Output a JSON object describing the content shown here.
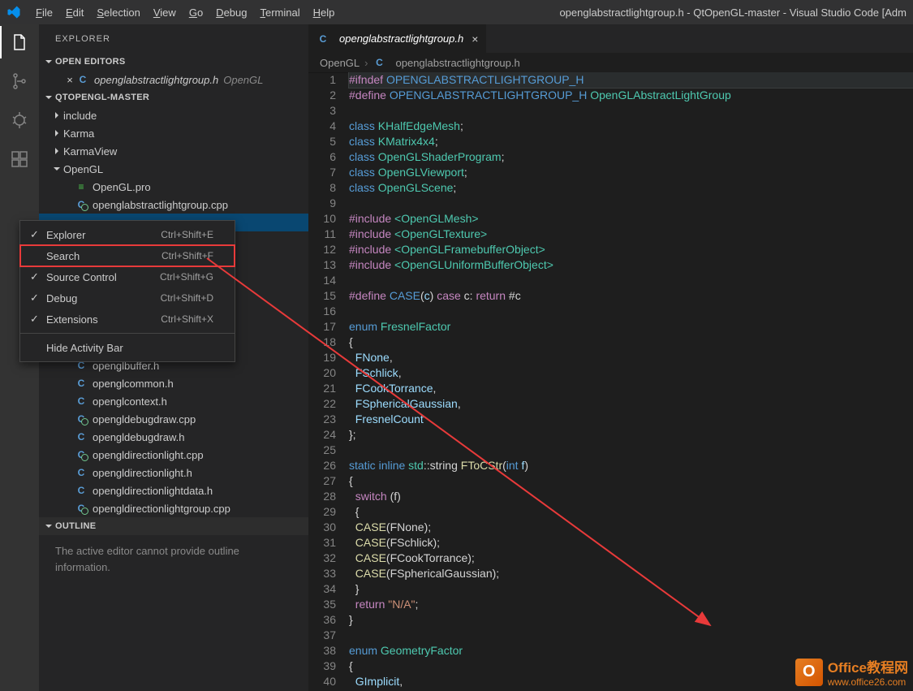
{
  "titlebar": {
    "menu": [
      "File",
      "Edit",
      "Selection",
      "View",
      "Go",
      "Debug",
      "Terminal",
      "Help"
    ],
    "title": "openglabstractlightgroup.h - QtOpenGL-master - Visual Studio Code [Adm"
  },
  "sidebar": {
    "title": "EXPLORER",
    "openEditorsLabel": "OPEN EDITORS",
    "openEditor": {
      "file": "openglabstractlightgroup.h",
      "folder": "OpenGL"
    },
    "projectLabel": "QTOPENGL-MASTER",
    "folders": [
      "include",
      "Karma",
      "KarmaView",
      "OpenGL"
    ],
    "filesTop": [
      {
        "icon": "qt",
        "name": "OpenGL.pro"
      },
      {
        "icon": "cg",
        "name": "openglabstractlightgroup.cpp"
      }
    ],
    "filesBottom": [
      {
        "icon": "c",
        "name": "openglbuffer.h"
      },
      {
        "icon": "c",
        "name": "openglcommon.h"
      },
      {
        "icon": "c",
        "name": "openglcontext.h"
      },
      {
        "icon": "cg",
        "name": "opengldebugdraw.cpp"
      },
      {
        "icon": "c",
        "name": "opengldebugdraw.h"
      },
      {
        "icon": "cg",
        "name": "opengldirectionlight.cpp"
      },
      {
        "icon": "c",
        "name": "opengldirectionlight.h"
      },
      {
        "icon": "c",
        "name": "opengldirectionlightdata.h"
      },
      {
        "icon": "cg",
        "name": "opengldirectionlightgroup.cpp"
      }
    ],
    "selectedHidden": "openglabstractlightgroup.h",
    "outlineLabel": "OUTLINE",
    "outlineMsg": "The active editor cannot provide outline information."
  },
  "contextMenu": [
    {
      "check": true,
      "label": "Explorer",
      "key": "Ctrl+Shift+E"
    },
    {
      "check": false,
      "label": "Search",
      "key": "Ctrl+Shift+F",
      "hl": true
    },
    {
      "check": true,
      "label": "Source Control",
      "key": "Ctrl+Shift+G"
    },
    {
      "check": true,
      "label": "Debug",
      "key": "Ctrl+Shift+D"
    },
    {
      "check": true,
      "label": "Extensions",
      "key": "Ctrl+Shift+X"
    },
    {
      "sep": true
    },
    {
      "check": false,
      "label": "Hide Activity Bar",
      "key": ""
    }
  ],
  "editor": {
    "tab": "openglabstractlightgroup.h",
    "breadcrumb": {
      "folder": "OpenGL",
      "file": "openglabstractlightgroup.h"
    }
  },
  "code": [
    {
      "n": 1,
      "hl": true,
      "h": "<span class='tk-pp'>#ifndef</span> <span class='tk-mac'>OPENGLABSTRACTLIGHTGROUP_H</span>"
    },
    {
      "n": 2,
      "h": "<span class='tk-pp'>#define</span> <span class='tk-mac'>OPENGLABSTRACTLIGHTGROUP_H</span> <span class='tk-cls'>OpenGLAbstractLightGroup</span>"
    },
    {
      "n": 3,
      "h": ""
    },
    {
      "n": 4,
      "h": "<span class='tk-kw'>class</span> <span class='tk-cls'>KHalfEdgeMesh</span>;"
    },
    {
      "n": 5,
      "h": "<span class='tk-kw'>class</span> <span class='tk-cls'>KMatrix4x4</span>;"
    },
    {
      "n": 6,
      "h": "<span class='tk-kw'>class</span> <span class='tk-cls'>OpenGLShaderProgram</span>;"
    },
    {
      "n": 7,
      "h": "<span class='tk-kw'>class</span> <span class='tk-cls'>OpenGLViewport</span>;"
    },
    {
      "n": 8,
      "h": "<span class='tk-kw'>class</span> <span class='tk-cls'>OpenGLScene</span>;"
    },
    {
      "n": 9,
      "h": ""
    },
    {
      "n": 10,
      "h": "<span class='tk-pp'>#include</span> <span class='tk-cls'>&lt;OpenGLMesh&gt;</span>"
    },
    {
      "n": 11,
      "h": "<span class='tk-pp'>#include</span> <span class='tk-cls'>&lt;OpenGLTexture&gt;</span>"
    },
    {
      "n": 12,
      "h": "<span class='tk-pp'>#include</span> <span class='tk-cls'>&lt;OpenGLFramebufferObject&gt;</span>"
    },
    {
      "n": 13,
      "h": "<span class='tk-pp'>#include</span> <span class='tk-cls'>&lt;OpenGLUniformBufferObject&gt;</span>"
    },
    {
      "n": 14,
      "h": ""
    },
    {
      "n": 15,
      "h": "<span class='tk-pp'>#define</span> <span class='tk-mac'>CASE</span>(<span class='tk-var'>c</span>) <span class='tk-pp'>case</span> c: <span class='tk-pp'>return</span> #c"
    },
    {
      "n": 16,
      "h": ""
    },
    {
      "n": 17,
      "h": "<span class='tk-kw'>enum</span> <span class='tk-cls'>FresnelFactor</span>"
    },
    {
      "n": 18,
      "h": "{"
    },
    {
      "n": 19,
      "h": "  <span class='tk-var'>FNone</span>,"
    },
    {
      "n": 20,
      "h": "  <span class='tk-var'>FSchlick</span>,"
    },
    {
      "n": 21,
      "h": "  <span class='tk-var'>FCookTorrance</span>,"
    },
    {
      "n": 22,
      "h": "  <span class='tk-var'>FSphericalGaussian</span>,"
    },
    {
      "n": 23,
      "h": "  <span class='tk-var'>FresnelCount</span>"
    },
    {
      "n": 24,
      "h": "};"
    },
    {
      "n": 25,
      "h": ""
    },
    {
      "n": 26,
      "h": "<span class='tk-kw'>static</span> <span class='tk-kw'>inline</span> <span class='tk-ty'>std</span>::string <span class='tk-fn'>FToCStr</span>(<span class='tk-kw'>int</span> <span class='tk-var'>f</span>)"
    },
    {
      "n": 27,
      "h": "{"
    },
    {
      "n": 28,
      "h": "  <span class='tk-pp'>switch</span> (f)"
    },
    {
      "n": 29,
      "h": "  {"
    },
    {
      "n": 30,
      "h": "  <span class='tk-fn'>CASE</span>(FNone);"
    },
    {
      "n": 31,
      "h": "  <span class='tk-fn'>CASE</span>(FSchlick);"
    },
    {
      "n": 32,
      "h": "  <span class='tk-fn'>CASE</span>(FCookTorrance);"
    },
    {
      "n": 33,
      "h": "  <span class='tk-fn'>CASE</span>(FSphericalGaussian);"
    },
    {
      "n": 34,
      "h": "  }"
    },
    {
      "n": 35,
      "h": "  <span class='tk-pp'>return</span> <span class='tk-str'>\"N/A\"</span>;"
    },
    {
      "n": 36,
      "h": "}"
    },
    {
      "n": 37,
      "h": ""
    },
    {
      "n": 38,
      "h": "<span class='tk-kw'>enum</span> <span class='tk-cls'>GeometryFactor</span>"
    },
    {
      "n": 39,
      "h": "{"
    },
    {
      "n": 40,
      "h": "  <span class='tk-var'>GImplicit</span>,"
    }
  ],
  "watermark": {
    "text1": "Office教程网",
    "text2": "www.office26.com"
  }
}
